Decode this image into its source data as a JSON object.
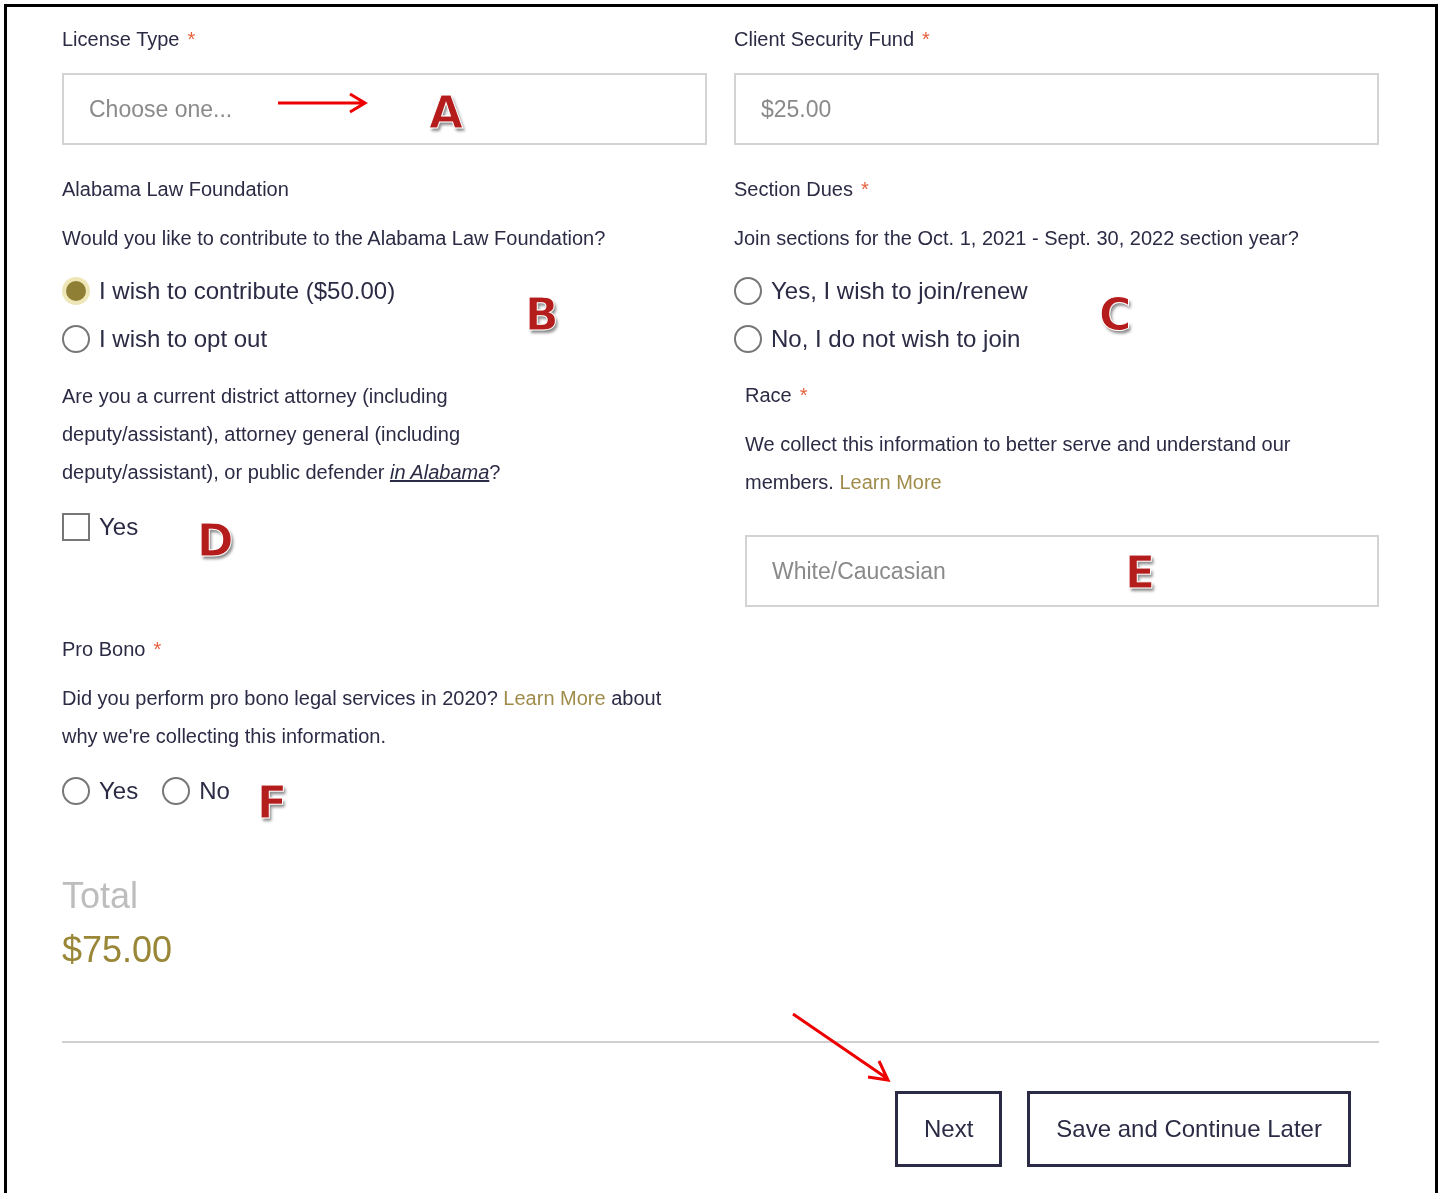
{
  "left": {
    "license_type": {
      "label": "License Type",
      "required_mark": "*",
      "placeholder": "Choose one..."
    },
    "foundation": {
      "title": "Alabama Law Foundation",
      "question": "Would you like to contribute to the Alabama Law Foundation?",
      "options": [
        {
          "label": "I wish to contribute ($50.00)",
          "selected": true
        },
        {
          "label": "I wish to opt out",
          "selected": false
        }
      ]
    },
    "attorney": {
      "question": "Are you a current district attorney (including deputy/assistant), attorney general (including deputy/assistant), or public defender ",
      "link": "in Alabama",
      "after": "?",
      "checkbox": {
        "label": "Yes",
        "checked": false
      }
    },
    "pro_bono": {
      "label": "Pro Bono",
      "required_mark": "*",
      "question": "Did you perform pro bono legal services in 2020? ",
      "link": "Learn More",
      "after": " about why we're collecting this information.",
      "options": [
        {
          "label": "Yes",
          "selected": false
        },
        {
          "label": "No",
          "selected": false
        }
      ]
    }
  },
  "right": {
    "security_fund": {
      "label": "Client Security Fund",
      "required_mark": "*",
      "value": "$25.00"
    },
    "section_dues": {
      "label": "Section Dues",
      "required_mark": "*",
      "question": "Join sections for the Oct. 1, 2021 - Sept. 30, 2022 section year?",
      "options": [
        {
          "label": "Yes, I wish to join/renew",
          "selected": false
        },
        {
          "label": "No, I do not wish to join",
          "selected": false
        }
      ]
    },
    "race": {
      "label": "Race",
      "required_mark": "*",
      "text": "We collect this information to better serve and understand our members. ",
      "link": "Learn More",
      "value": "White/Caucasian"
    }
  },
  "total": {
    "label": "Total",
    "amount": "$75.00"
  },
  "buttons": [
    "Next",
    "Save and Continue Later"
  ],
  "annotations": [
    "A",
    "B",
    "C",
    "D",
    "E",
    "F"
  ]
}
